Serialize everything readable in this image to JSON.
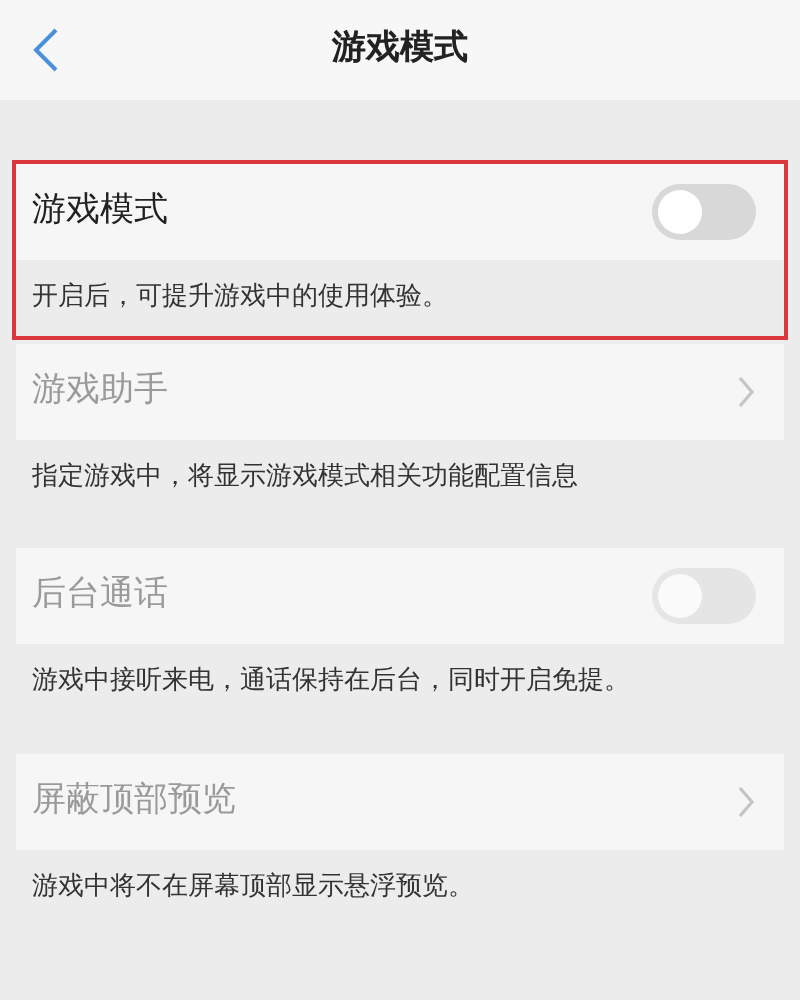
{
  "header": {
    "title": "游戏模式"
  },
  "items": [
    {
      "kind": "toggle",
      "title": "游戏模式",
      "on": false,
      "disabled": false,
      "highlighted": true,
      "description": "开启后，可提升游戏中的使用体验。"
    },
    {
      "kind": "link",
      "title": "游戏助手",
      "disabled": true,
      "highlighted": false,
      "description": "指定游戏中，将显示游戏模式相关功能配置信息"
    },
    {
      "kind": "toggle",
      "title": "后台通话",
      "on": false,
      "disabled": true,
      "highlighted": false,
      "description": "游戏中接听来电，通话保持在后台，同时开启免提。"
    },
    {
      "kind": "link",
      "title": "屏蔽顶部预览",
      "disabled": true,
      "highlighted": false,
      "description": "游戏中将不在屏幕顶部显示悬浮预览。"
    }
  ]
}
